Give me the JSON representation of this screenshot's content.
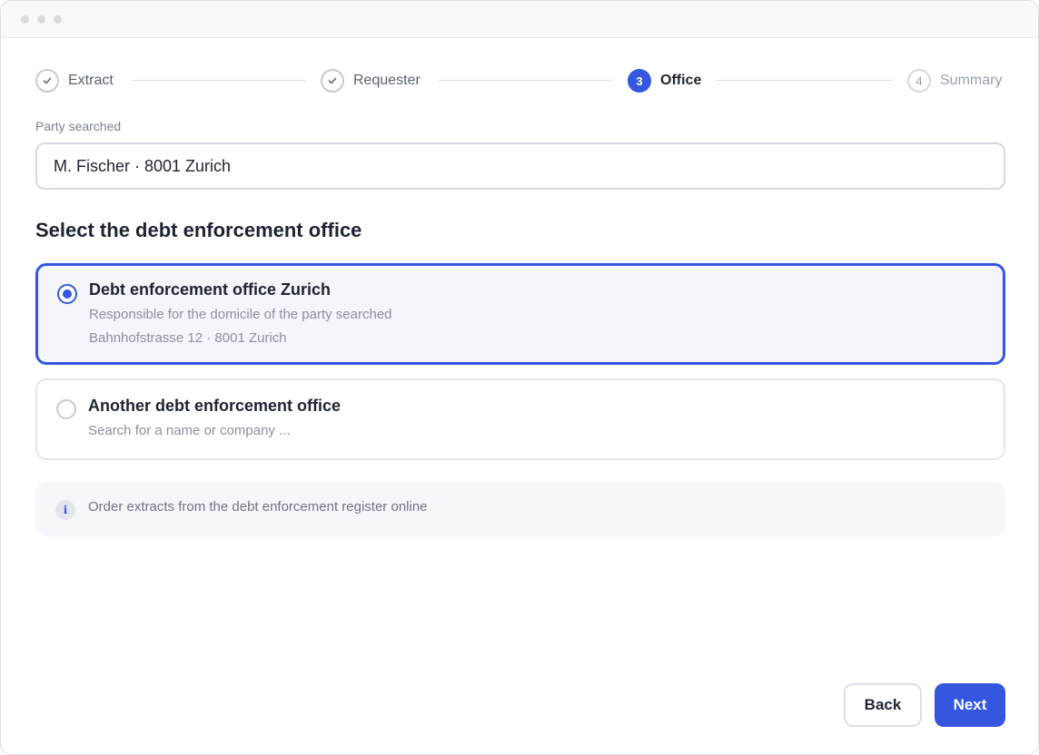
{
  "stepper": {
    "steps": [
      {
        "label": "Extract",
        "marker": "",
        "state": "done"
      },
      {
        "label": "Requester",
        "marker": "",
        "state": "done"
      },
      {
        "label": "Office",
        "marker": "3",
        "state": "active"
      },
      {
        "label": "Summary",
        "marker": "4",
        "state": "pending"
      }
    ]
  },
  "party": {
    "label": "Party searched",
    "value": "M. Fischer · 8001 Zurich"
  },
  "section_title": "Select the debt enforcement office",
  "options": [
    {
      "title": "Debt enforcement office Zurich",
      "subtitle": "Responsible for the domicile of the party searched",
      "address": "Bahnhofstrasse 12 · 8001 Zurich",
      "selected": true
    },
    {
      "title": "Another debt enforcement office",
      "subtitle": "Search for a name or company ...",
      "selected": false
    }
  ],
  "info": {
    "icon": "i",
    "text": "Order extracts from the debt enforcement register online"
  },
  "buttons": {
    "back": "Back",
    "next": "Next"
  },
  "colors": {
    "accent": "#3557e0",
    "selected_bg": "#f5f6fb"
  }
}
